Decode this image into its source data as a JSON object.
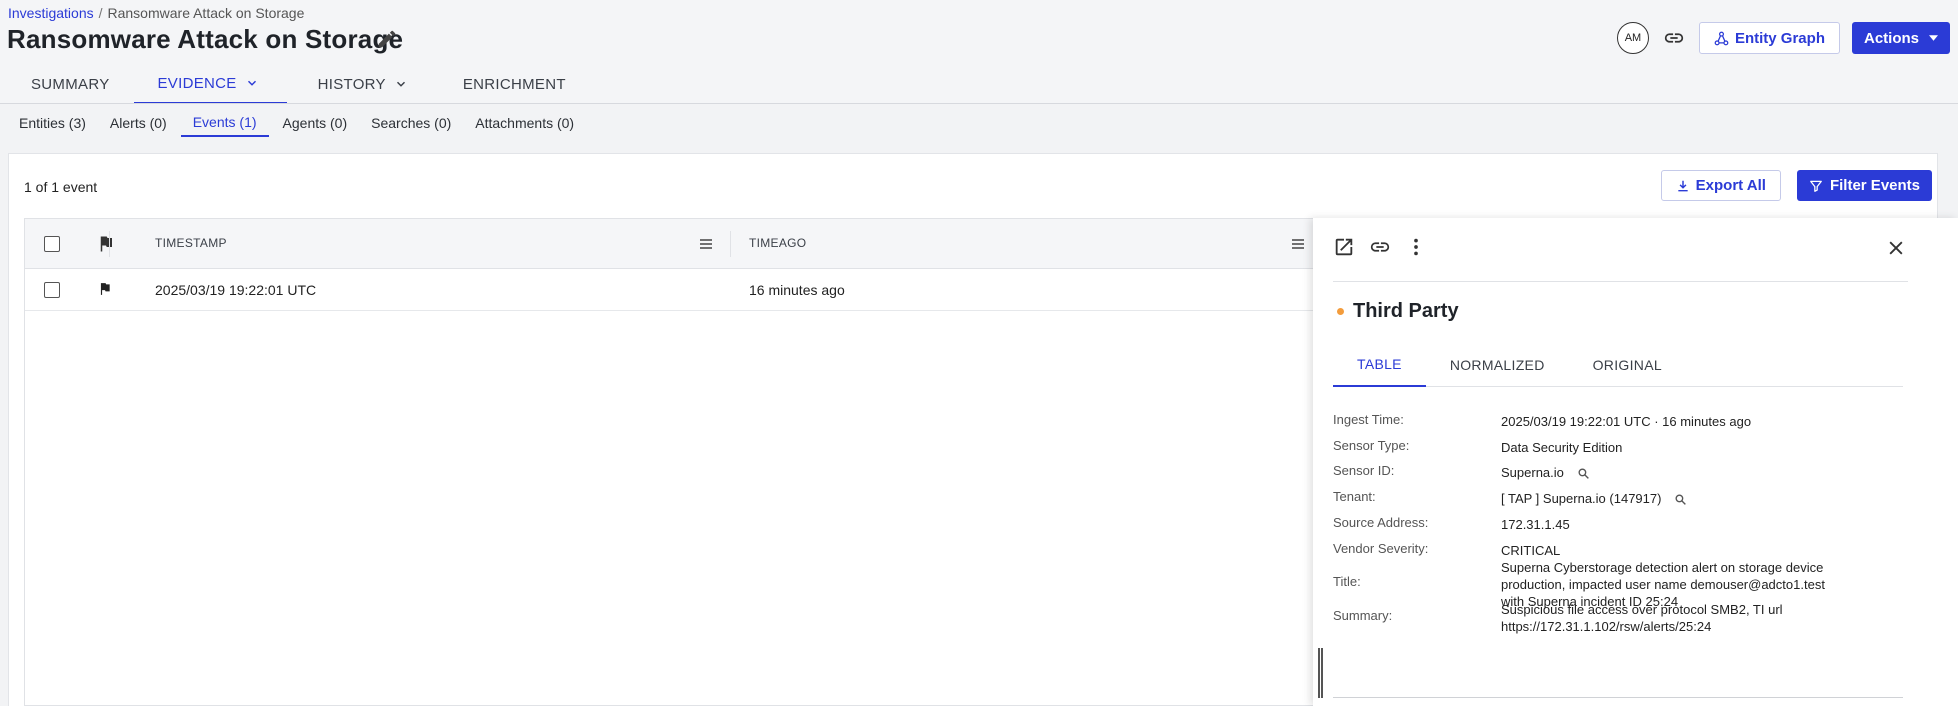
{
  "breadcrumb": {
    "root": "Investigations",
    "current": "Ransomware Attack on Storage"
  },
  "page_title": "Ransomware Attack on Storage",
  "header": {
    "avatar_initials": "AM",
    "entity_graph_label": "Entity Graph",
    "actions_label": "Actions"
  },
  "main_tabs": [
    {
      "label": "SUMMARY"
    },
    {
      "label": "EVIDENCE"
    },
    {
      "label": "HISTORY"
    },
    {
      "label": "ENRICHMENT"
    }
  ],
  "sub_tabs": [
    {
      "label": "Entities (3)"
    },
    {
      "label": "Alerts (0)"
    },
    {
      "label": "Events (1)"
    },
    {
      "label": "Agents (0)"
    },
    {
      "label": "Searches (0)"
    },
    {
      "label": "Attachments (0)"
    }
  ],
  "events": {
    "count_text": "1 of 1 event",
    "export_label": "Export All",
    "filter_label": "Filter Events",
    "columns": {
      "timestamp": "TIMESTAMP",
      "timeago": "TIMEAGO"
    },
    "rows": [
      {
        "timestamp": "2025/03/19 19:22:01 UTC",
        "timeago": "16 minutes ago"
      }
    ]
  },
  "detail": {
    "title": "Third Party",
    "tabs": [
      {
        "label": "TABLE"
      },
      {
        "label": "NORMALIZED"
      },
      {
        "label": "ORIGINAL"
      }
    ],
    "fields": [
      {
        "key": "Ingest Time:",
        "value": "2025/03/19 19:22:01 UTC · 16 minutes ago"
      },
      {
        "key": "Sensor Type:",
        "value": "Data Security Edition"
      },
      {
        "key": "Sensor ID:",
        "value": "Superna.io"
      },
      {
        "key": "Tenant:",
        "value": "[ TAP ] Superna.io (147917)"
      },
      {
        "key": "Source Address:",
        "value": "172.31.1.45"
      },
      {
        "key": "Vendor Severity:",
        "value": "CRITICAL"
      },
      {
        "key": "Title:",
        "value": "Superna Cyberstorage detection alert on storage device production, impacted user name demouser@adcto1.test with Superna incident ID 25:24"
      },
      {
        "key": "Summary:",
        "value": "Suspicious file access over protocol SMB2, TI url https://172.31.1.102/rsw/alerts/25:24"
      }
    ]
  },
  "colors": {
    "accent": "#2b3bd6",
    "severity_dot": "#f39c3c"
  }
}
